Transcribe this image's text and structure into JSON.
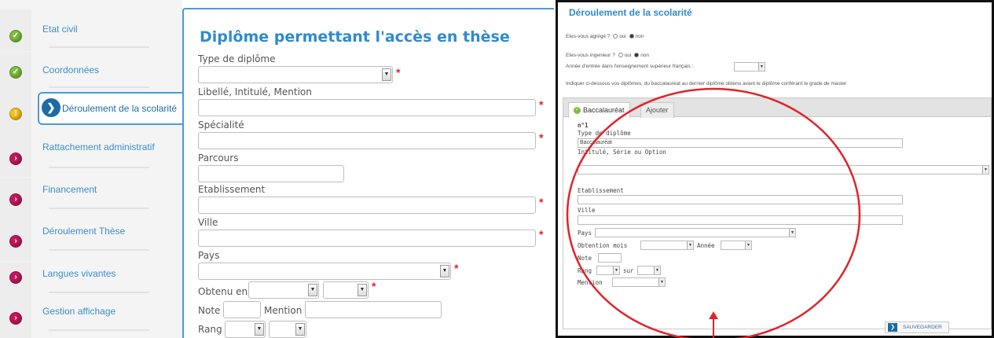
{
  "sidebar": {
    "items": [
      {
        "label": "Etat civil",
        "status": "check",
        "color": "#7cbf3a"
      },
      {
        "label": "Coordonnées",
        "status": "check",
        "color": "#7cbf3a"
      },
      {
        "label": "Déroulement de la scolarité",
        "status": "warning",
        "color": "#f5c21b"
      },
      {
        "label": "Rattachement administratif",
        "status": "arrow",
        "color": "#c3185b"
      },
      {
        "label": "Financement",
        "status": "arrow",
        "color": "#c3185b"
      },
      {
        "label": "Déroulement Thèse",
        "status": "arrow",
        "color": "#c3185b"
      },
      {
        "label": "Langues vivantes",
        "status": "arrow",
        "color": "#c3185b"
      },
      {
        "label": "Gestion affichage",
        "status": "arrow",
        "color": "#c3185b"
      }
    ]
  },
  "form": {
    "title": "Diplôme permettant l'accès en thèse",
    "type_diplome": "Type de diplôme",
    "libelle": "Libellé, Intitulé, Mention",
    "specialite": "Spécialité",
    "parcours": "Parcours",
    "etablissement": "Etablissement",
    "ville": "Ville",
    "pays": "Pays",
    "obtenu_en": "Obtenu en",
    "note": "Note",
    "mention": "Mention",
    "rang": "Rang"
  },
  "right": {
    "title": "Déroulement de la scolarité",
    "agrege": "Etes-vous agrégé ?",
    "ingenieur": "Etes-vous ingenieur ?",
    "oui": "oui",
    "non": "non",
    "annee_entree": "Année d'entrée dans l'enseignement supérieur français :",
    "instructions": "Indiquer ci-dessous vos diplômes, du baccalauréat au dernier diplôme obtenu avant le diplôme conférant le grade de master",
    "tab_bac": "Baccalauréat",
    "tab_ajouter": "Ajouter",
    "n1": "n°1",
    "type_diplome": "Type de diplôme",
    "type_value": "Baccalauréat",
    "intitule": "Intitulé, Série ou Option",
    "etablissement": "Etablissement",
    "ville": "Ville",
    "pays": "Pays",
    "obtention_mois": "Obtention mois",
    "annee": "Année",
    "note": "Note",
    "rang": "Rang",
    "sur": "sur",
    "mention": "Mention",
    "save": "SAUVEGARDER"
  },
  "colors": {
    "accent": "#2f8ad0",
    "active_nav": "#1c6ca3",
    "required": "#e0232b",
    "annotation": "#e0232b"
  }
}
